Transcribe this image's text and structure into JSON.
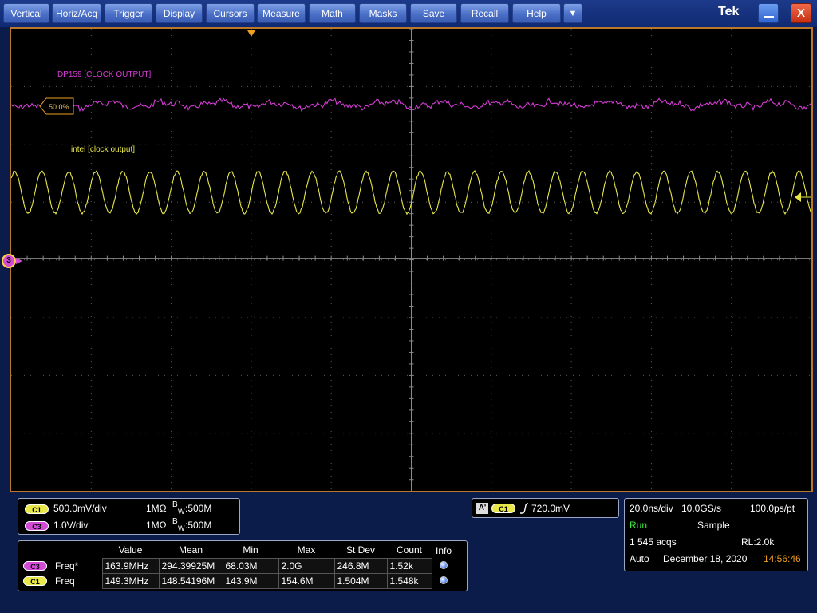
{
  "menu": {
    "items": [
      "Vertical",
      "Horiz/Acq",
      "Trigger",
      "Display",
      "Cursors",
      "Measure",
      "Math",
      "Masks",
      "Save",
      "Recall",
      "Help"
    ],
    "more_arrow": "▼",
    "brand": "Tek",
    "close_label": "X"
  },
  "waveforms": {
    "ch3_label": "DP159 [CLOCK OUTPUT]",
    "ch1_label": "intel [clock output]",
    "trigger_level_marker": "50.0%",
    "ch3_ground_marker": "3",
    "colors": {
      "ch1": "#e8e84a",
      "ch3": "#d63cd6",
      "grid": "#5a5a5a",
      "frame": "#b9782a"
    }
  },
  "channels": [
    {
      "badge": "C1",
      "scale": "500.0mV/div",
      "impedance": "1MΩ",
      "bw_prefix": "B",
      "bw_sub": "W",
      "bw_value": ":500M"
    },
    {
      "badge": "C3",
      "scale": "1.0V/div",
      "impedance": "1MΩ",
      "bw_prefix": "B",
      "bw_sub": "W",
      "bw_value": ":500M"
    }
  ],
  "measurements": {
    "headers": [
      "Value",
      "Mean",
      "Min",
      "Max",
      "St Dev",
      "Count",
      "Info"
    ],
    "rows": [
      {
        "badge": "C3",
        "name": "Freq*",
        "value": "163.9MHz",
        "mean": "294.39925M",
        "min": "68.03M",
        "max": "2.0G",
        "stdev": "246.8M",
        "count": "1.52k"
      },
      {
        "badge": "C1",
        "name": "Freq",
        "value": "149.3MHz",
        "mean": "148.54196M",
        "min": "143.9M",
        "max": "154.6M",
        "stdev": "1.504M",
        "count": "1.548k"
      }
    ]
  },
  "trigger": {
    "a_label": "A'",
    "source": "C1",
    "slope_icon": "rising-edge",
    "level": "720.0mV"
  },
  "acquisition": {
    "time_div": "20.0ns/div",
    "sample_rate": "10.0GS/s",
    "resolution": "100.0ps/pt",
    "state": "Run",
    "mode": "Sample",
    "acqs": "1 545 acqs",
    "record_length": "RL:2.0k",
    "trigger_mode": "Auto",
    "date": "December 18, 2020",
    "time": "14:56:46"
  }
}
